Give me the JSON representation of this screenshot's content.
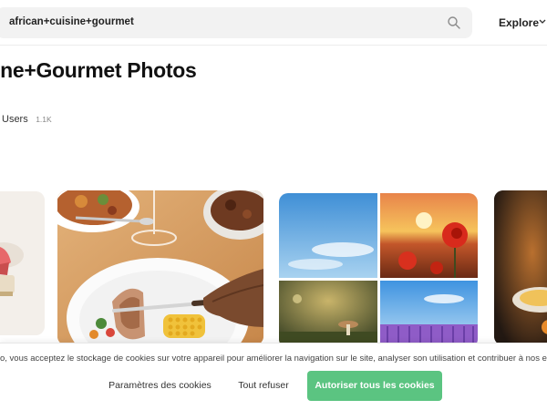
{
  "search": {
    "query": "african+cuisine+gourmet"
  },
  "header": {
    "explore_label": "Explore"
  },
  "main": {
    "title": "ine+Gourmet Photos",
    "filter": {
      "label": "Users",
      "count": "1.1K"
    }
  },
  "gallery": {
    "items": [
      {
        "subject": "plated dish partial"
      },
      {
        "subject": "grilled food with corn and fish"
      },
      {
        "subject": "nature collage: sky, sunset poppies, mushroom, lavender"
      },
      {
        "subject": "warm dark food partial"
      }
    ]
  },
  "cookies": {
    "message": "o, vous acceptez le stockage de cookies sur votre appareil pour améliorer la navigation sur le site, analyser son utilisation et contribuer à nos ef",
    "params_label": "Paramètres des cookies",
    "refuse_label": "Tout refuser",
    "accept_label": "Autoriser tous les cookies",
    "accept_color": "#5bc481"
  }
}
